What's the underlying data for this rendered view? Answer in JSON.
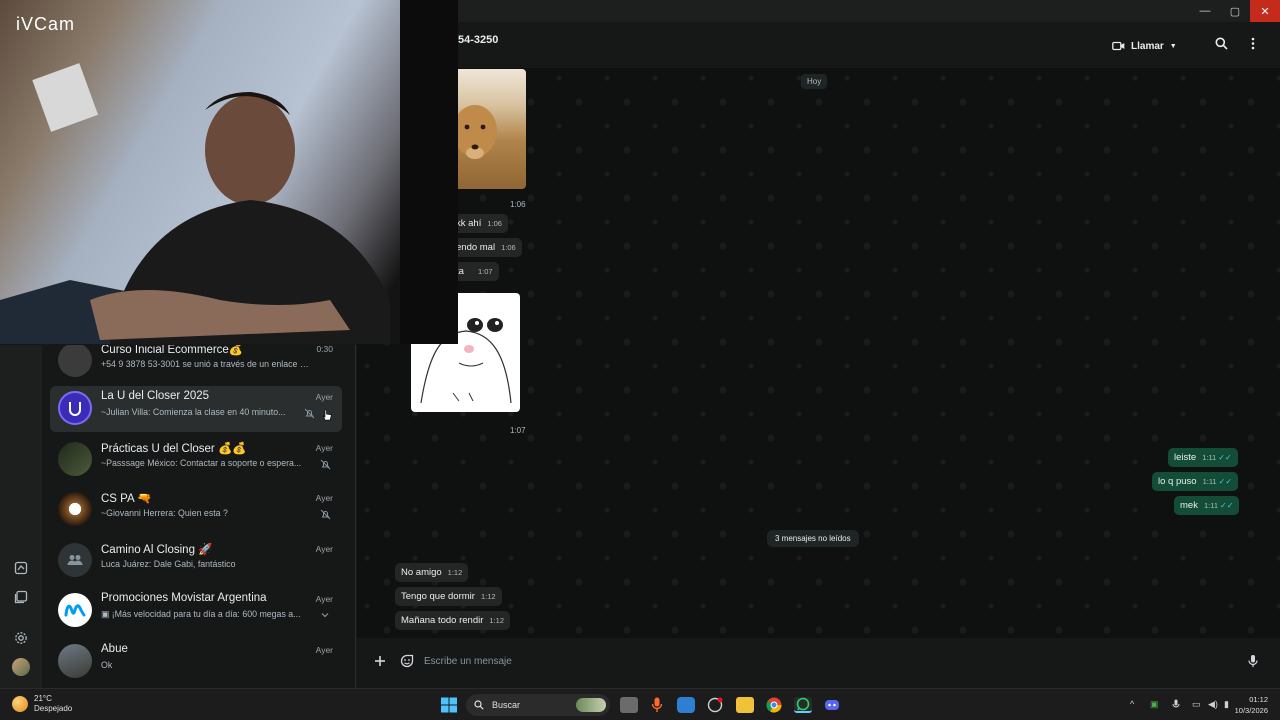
{
  "window": {
    "minimize": "—",
    "maximize": "▢",
    "close": "✕"
  },
  "webcam": {
    "brand": "iVCam"
  },
  "conversation": {
    "contact_name": "54-3250",
    "call_label": "Llamar",
    "day_label": "Hoy",
    "incoming_fragments": [
      {
        "text": "kk ahí",
        "time": "1:06"
      },
      {
        "text": "endo mal",
        "time": "1:06"
      },
      {
        "text": "ta",
        "time": "1:07"
      }
    ],
    "image1_time": "1:06",
    "image2_time": "1:07",
    "outgoing": [
      {
        "text": "leiste",
        "time": "1:11"
      },
      {
        "text": "lo q puso",
        "time": "1:11"
      },
      {
        "text": "mek",
        "time": "1:11"
      }
    ],
    "unread_label": "3 mensajes no leídos",
    "incoming_new": [
      {
        "text": "No amigo",
        "time": "1:12"
      },
      {
        "text": "Tengo que dormir",
        "time": "1:12"
      },
      {
        "text": "Mañana todo rendir",
        "time": "1:12"
      }
    ],
    "composer_placeholder": "Escribe un mensaje"
  },
  "chats": [
    {
      "name": "Curso Inicial Ecommerce💰",
      "time": "0:30",
      "preview": "+54 9 3878 53-3001 se unió a través de un enlace de...",
      "avatar_color": "#3b3b3b",
      "muted": false
    },
    {
      "name": "La U del Closer 2025",
      "time": "Ayer",
      "preview": "~Julian Villa: Comienza la clase en 40 minuto...",
      "avatar_color": "#3a2bb8",
      "muted": true
    },
    {
      "name": "Prácticas U del Closer 💰💰",
      "time": "Ayer",
      "preview": "~Passsage México: Contactar a soporte o espera...",
      "avatar_color": "#2c3a2a",
      "muted": true
    },
    {
      "name": "CS PA 🔫",
      "time": "Ayer",
      "preview": "~Giovanni Herrera: Quien esta ?",
      "avatar_color": "#5a3a22",
      "muted": true
    },
    {
      "name": "Camino Al Closing 🚀",
      "time": "Ayer",
      "preview": "Luca Juárez: Dale Gabi, fantástico",
      "avatar_color": "#2f3436",
      "muted": false
    },
    {
      "name": "Promociones Movistar Argentina",
      "time": "Ayer",
      "preview": "▣ ¡Más velocidad para tu día a día: 600 megas a...",
      "avatar_color": "#ffffff",
      "muted": false
    },
    {
      "name": "Abue",
      "time": "Ayer",
      "preview": "Ok",
      "avatar_color": "#55606a",
      "muted": false
    }
  ],
  "taskbar": {
    "temperature": "21°C",
    "weather": "Despejado",
    "search_label": "Buscar",
    "time": "01:12",
    "date": "10/3/2026"
  }
}
